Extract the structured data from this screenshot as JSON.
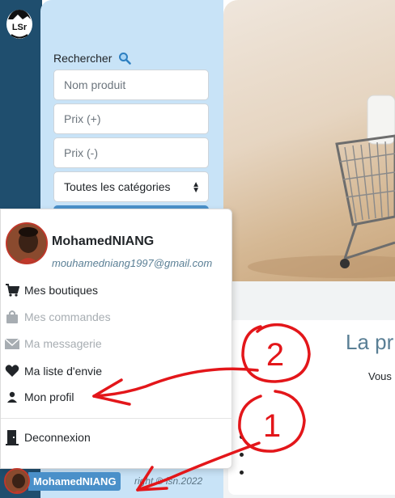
{
  "brand": {
    "logo_text": "LSr"
  },
  "search": {
    "label": "Rechercher",
    "name_placeholder": "Nom produit",
    "price_max_placeholder": "Prix (+)",
    "price_min_placeholder": "Prix (-)",
    "category_select": "Toutes les catégories"
  },
  "main": {
    "title_partial": "La pr",
    "subtitle_partial": "Vous"
  },
  "footer": {
    "copyright": "right © lsn.2022"
  },
  "user_menu": {
    "username": "MohamedNIANG",
    "email": "mouhamedniang1997@gmail.com",
    "items": [
      {
        "label": "Mes boutiques",
        "icon": "cart-icon",
        "enabled": true
      },
      {
        "label": "Mes commandes",
        "icon": "shopping-bag-icon",
        "enabled": false
      },
      {
        "label": "Ma messagerie",
        "icon": "envelope-icon",
        "enabled": false
      },
      {
        "label": "Ma liste d'envie",
        "icon": "heart-icon",
        "enabled": true
      },
      {
        "label": "Mon profil",
        "icon": "person-icon",
        "enabled": true
      }
    ],
    "logout_label": "Deconnexion"
  },
  "account_trigger": {
    "label": "MohamedNIANG"
  },
  "annotations": {
    "marker_1": "1",
    "marker_2": "2"
  },
  "colors": {
    "rail": "#1f4e6e",
    "sidebar": "#c8e3f7",
    "accent": "#4a90c9",
    "muted_text": "#a7adb2",
    "annotation_red": "#e3161a",
    "heading": "#5a7f95"
  }
}
